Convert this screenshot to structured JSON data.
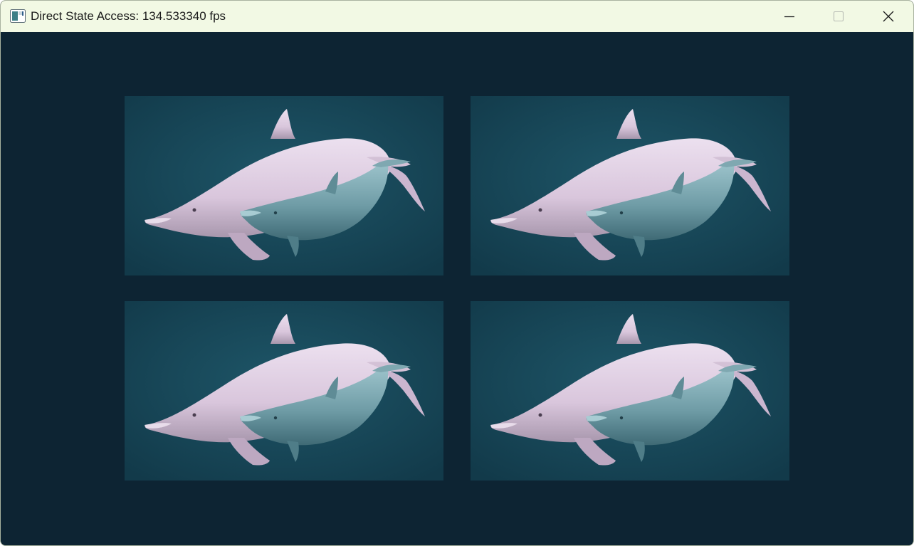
{
  "window": {
    "title": "Direct State Access: 134.533340 fps",
    "app_icon": "window-app-icon",
    "controls": {
      "minimize_icon": "minimize-icon",
      "maximize_icon": "maximize-icon",
      "close_icon": "close-icon"
    }
  },
  "viewport": {
    "background_color": "#0d2433",
    "tiles": [
      {
        "image": "dolphins-image"
      },
      {
        "image": "dolphins-image"
      },
      {
        "image": "dolphins-image"
      },
      {
        "image": "dolphins-image"
      }
    ]
  },
  "colors": {
    "titlebar": "#f2f9e4",
    "tile_water_center": "#1e5668",
    "tile_water_edge": "#123a4a",
    "adult_dolphin": "#d9c6dc",
    "calf_dolphin": "#6f9ca6"
  }
}
